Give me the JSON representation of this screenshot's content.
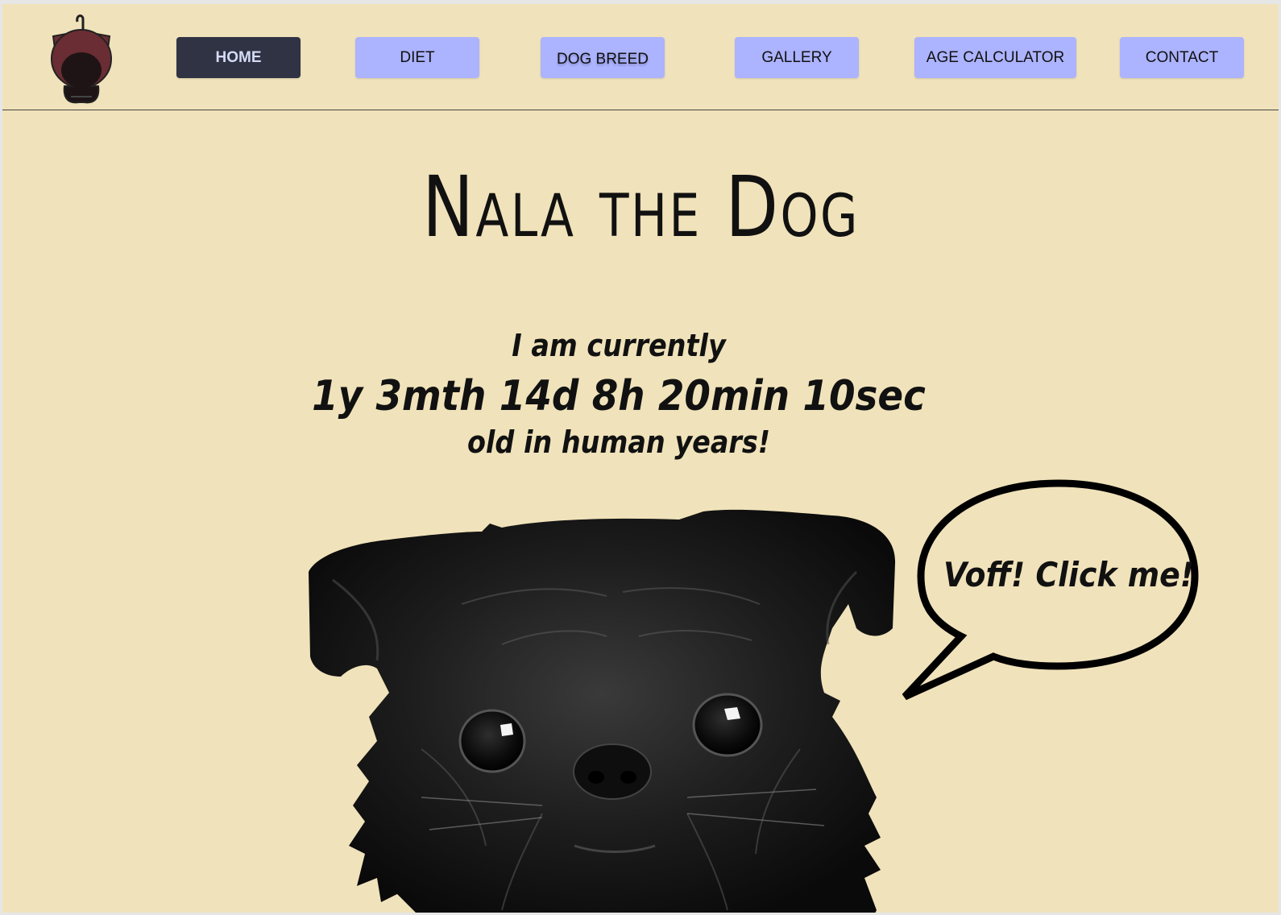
{
  "nav": {
    "items": [
      {
        "label": "HOME",
        "active": true
      },
      {
        "label": "DIET",
        "active": false
      },
      {
        "label": "DOG BREED",
        "active": false
      },
      {
        "label": "GALLERY",
        "active": false
      },
      {
        "label": "AGE CALCULATOR",
        "active": false
      },
      {
        "label": "CONTACT",
        "active": false
      }
    ]
  },
  "hero": {
    "title": "Nala the Dog",
    "age_intro": "I am currently",
    "age_value": "1y 3mth 14d  8h 20min 10sec",
    "age_outro": "old in human years!"
  },
  "speech_bubble": {
    "text": "Voff! Click me!"
  },
  "colors": {
    "page_background": "#f0e2ba",
    "nav_button": "#acb3ff",
    "nav_button_active": "#2f3344",
    "text": "#111111"
  },
  "icons": {
    "logo": "dog-icon"
  }
}
